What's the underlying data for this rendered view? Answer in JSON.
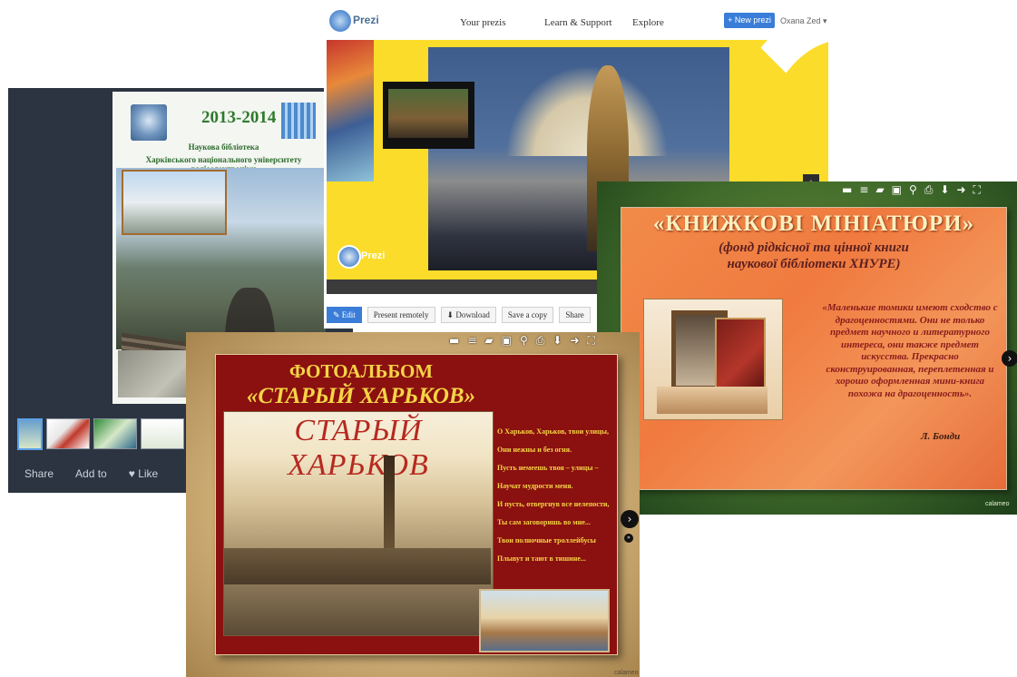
{
  "left_viewer": {
    "year": "2013-2014",
    "line1": "Наукова бібліотека",
    "line2": "Харківського національного університету радіоелектроніки",
    "bottom": {
      "share": "Share",
      "add_to": "Add to",
      "like": "♥ Like"
    }
  },
  "prezi": {
    "brand": "Prezi",
    "nav": [
      "Your prezis",
      "Learn & Support",
      "Explore"
    ],
    "new_button": "+ New prezi",
    "user": "Oxana Zed ▾",
    "stage_logo": "Prezi",
    "actions": [
      "✎ Edit",
      "Present remotely",
      "⬇ Download",
      "Save a copy",
      "Share"
    ]
  },
  "calameo_right": {
    "title": "«КНИЖКОВІ МІНІАТЮРИ»",
    "subtitle1": "(фонд рідкісної та цінної книги",
    "subtitle2": "наукової бібліотеки ХНУРЕ)",
    "quote": "«Маленькие томики имеют сходство с драгоценностями. Они не только предмет научного и литературного интереса, они также предмет искусства. Прекрасно сконструированная, переплетенная и хорошо оформленная мини-книга похожа на драгоценность».",
    "author": "Л. Бонди",
    "toolbar_icons": [
      "book-icon",
      "list-icon",
      "folder-icon",
      "print-icon",
      "search-icon",
      "printer-icon",
      "download-icon",
      "share-icon",
      "fullscreen-icon"
    ],
    "brand": "calameo"
  },
  "album": {
    "title": "ФОТОАЛЬБОМ",
    "subtitle": "«СТАРЫЙ ХАРЬКОВ»",
    "card_title": "СТАРЫЙ ХАРЬКОВ",
    "poem": [
      "О Харьков, Харьков, твои улицы,",
      "Они нежны и без огня.",
      "Пусть немеешь твоя – улицы –",
      "Научат мудрости меня.",
      "И пусть, отвергнув все нелепости,",
      "Ты сам заговоришь во мне...",
      "Твои полночные троллейбусы",
      "Плывут и тают в тишине..."
    ],
    "brand": "calameo"
  }
}
